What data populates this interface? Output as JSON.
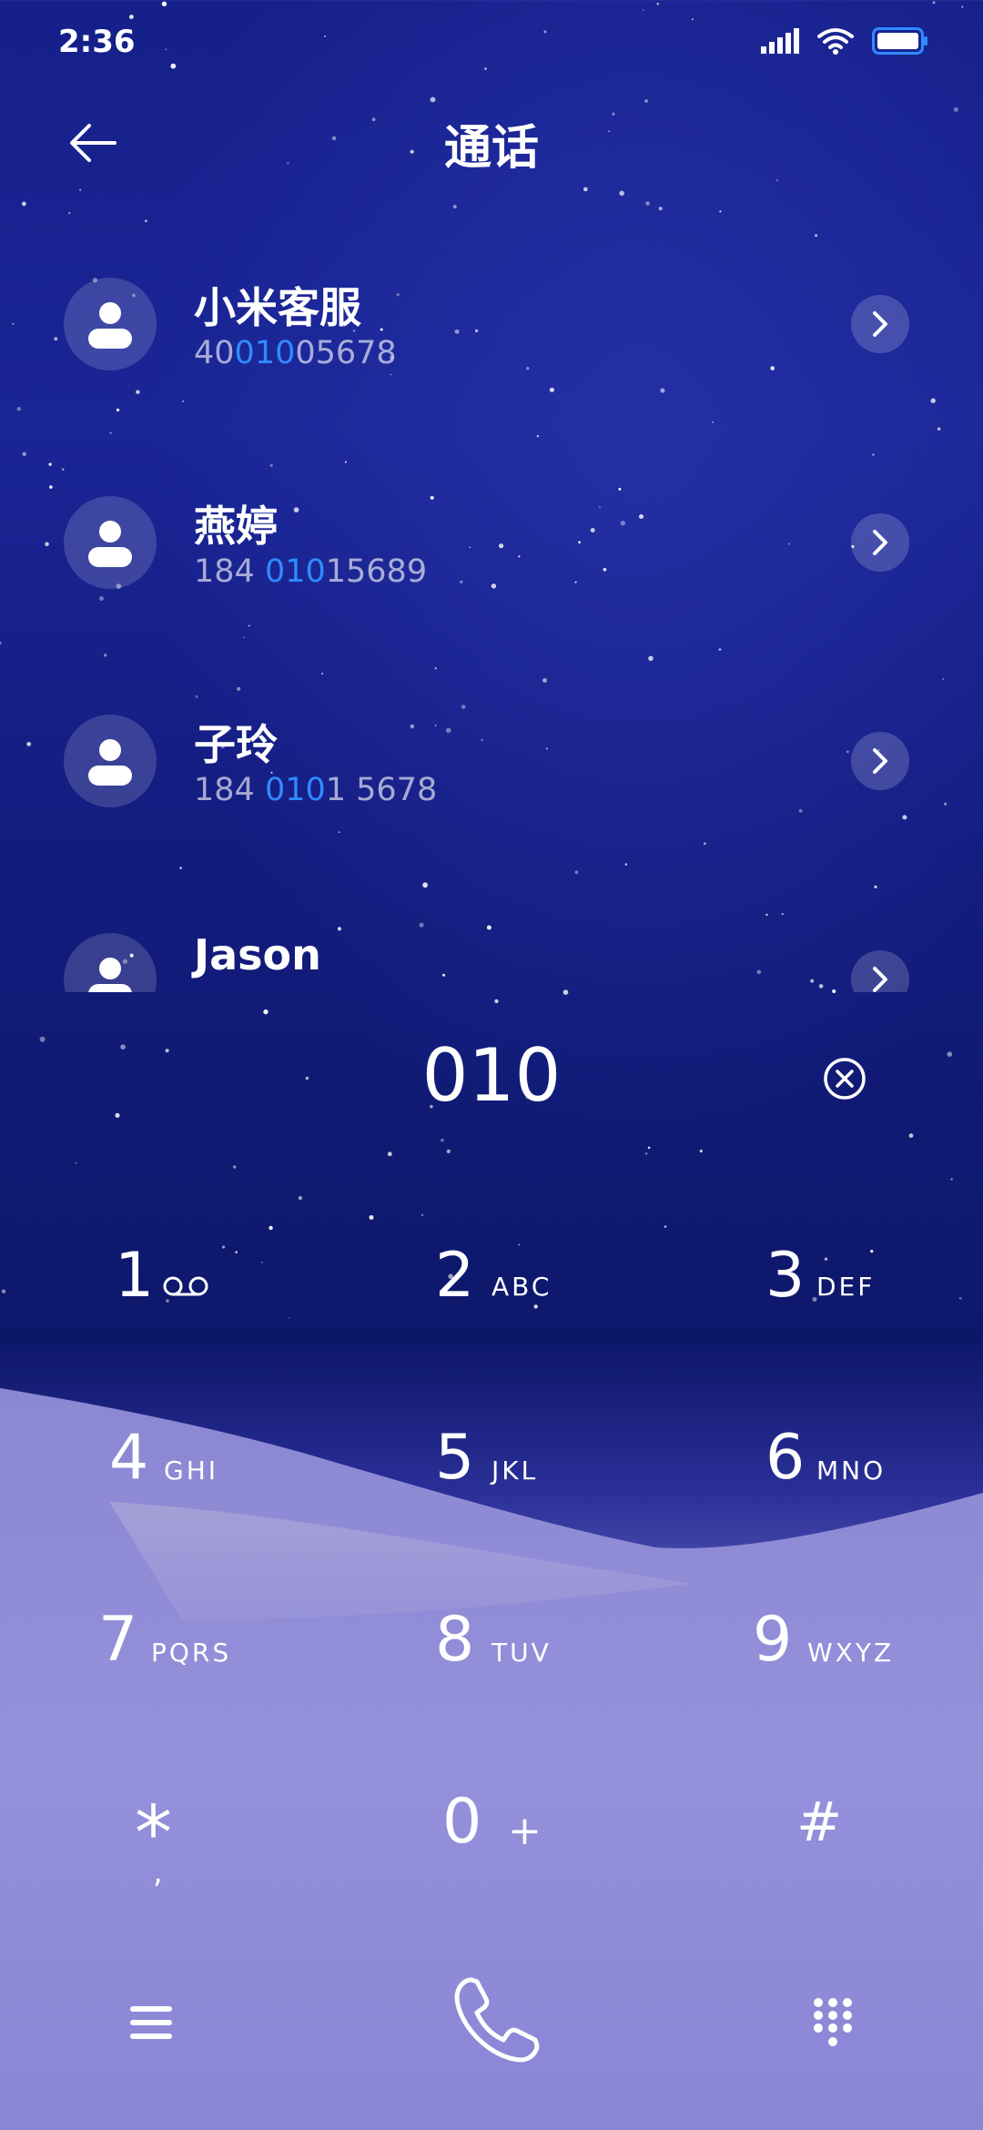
{
  "status_bar": {
    "time": "2:36"
  },
  "header": {
    "title": "通话"
  },
  "contacts": [
    {
      "name": "小米客服",
      "number": [
        {
          "t": "40",
          "hl": false
        },
        {
          "t": "010",
          "hl": true
        },
        {
          "t": "05678",
          "hl": false
        }
      ]
    },
    {
      "name": "燕婷",
      "number": [
        {
          "t": "184 ",
          "hl": false
        },
        {
          "t": "010",
          "hl": true
        },
        {
          "t": "15689",
          "hl": false
        }
      ]
    },
    {
      "name": "子玲",
      "number": [
        {
          "t": "184 ",
          "hl": false
        },
        {
          "t": "010",
          "hl": true
        },
        {
          "t": "1 5678",
          "hl": false
        }
      ]
    },
    {
      "name": "Jason",
      "number": []
    }
  ],
  "dialer": {
    "input": "010"
  },
  "keypad": [
    {
      "digit": "1",
      "letters": ""
    },
    {
      "digit": "2",
      "letters": "ABC"
    },
    {
      "digit": "3",
      "letters": "DEF"
    },
    {
      "digit": "4",
      "letters": "GHI"
    },
    {
      "digit": "5",
      "letters": "JKL"
    },
    {
      "digit": "6",
      "letters": "MNO"
    },
    {
      "digit": "7",
      "letters": "PQRS"
    },
    {
      "digit": "8",
      "letters": "TUV"
    },
    {
      "digit": "9",
      "letters": "WXYZ"
    },
    {
      "digit": "*",
      "letters": ","
    },
    {
      "digit": "0",
      "letters": "+"
    },
    {
      "digit": "#",
      "letters": ""
    }
  ],
  "icons": {
    "back": "arrow-left-icon",
    "clear": "clear-circle-icon",
    "voicemail": "voicemail-icon",
    "menu": "menu-icon",
    "call": "phone-icon",
    "dialpad": "dialpad-icon"
  },
  "colors": {
    "highlight": "#2f8bff",
    "battery": "#2f8bff"
  }
}
